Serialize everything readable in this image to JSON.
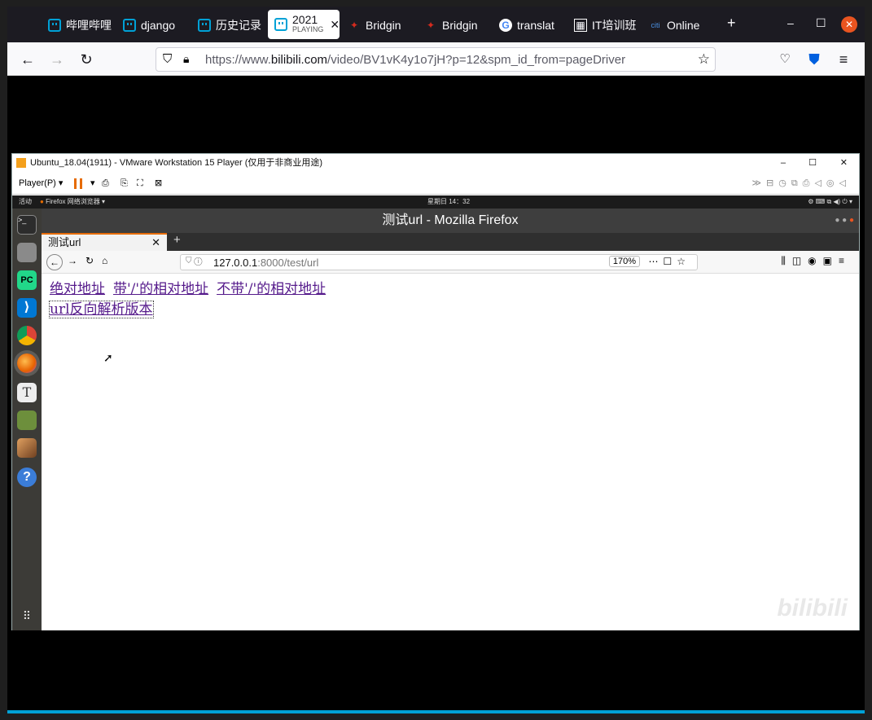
{
  "outer_browser": {
    "tabs": [
      {
        "label": "哔哩哔哩",
        "icon": "bilibili-icon"
      },
      {
        "label": "django",
        "icon": "bilibili-icon"
      },
      {
        "label": "历史记录",
        "icon": "bilibili-icon"
      },
      {
        "label": "2021",
        "sub": "PLAYING",
        "icon": "bilibili-icon",
        "active": true
      },
      {
        "label": "Bridgin",
        "icon": "maple-leaf-icon"
      },
      {
        "label": "Bridgin",
        "icon": "maple-leaf-icon"
      },
      {
        "label": "translat",
        "icon": "google-icon"
      },
      {
        "label": "IT培训班",
        "icon": "it-icon"
      },
      {
        "label": "Online",
        "icon": "citi-icon"
      }
    ],
    "url_prefix": "https://www.",
    "url_domain": "bilibili.com",
    "url_suffix": "/video/BV1vK4y1o7jH?p=12&spm_id_from=pageDriver",
    "new_tab_symbol": "+"
  },
  "vmware": {
    "title": "Ubuntu_18.04(1911) - VMware Workstation 15 Player (仅用于非商业用途)",
    "player_menu": "Player(P)"
  },
  "ubuntu": {
    "activities": "活动",
    "app_menu": "Firefox 网络浏览器",
    "clock": "星期日 14：32"
  },
  "inner_firefox": {
    "window_title": "测试url - Mozilla Firefox",
    "tab_label": "测试url",
    "url_host": "127.0.0.1",
    "url_rest": ":8000/test/url",
    "zoom": "170%"
  },
  "page": {
    "links": [
      "绝对地址",
      "带'/'的相对地址",
      "不带'/'的相对地址",
      "url反向解析版本"
    ]
  },
  "watermark": "bilibili"
}
